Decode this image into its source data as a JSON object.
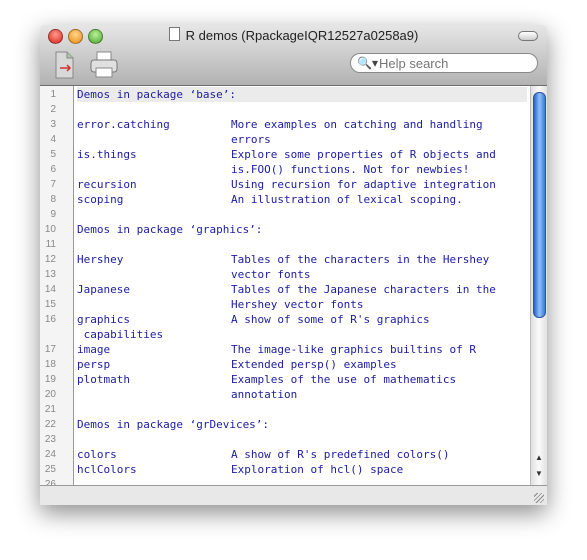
{
  "window": {
    "title": "R demos (RpackageIQR12527a0258a9)"
  },
  "toolbar": {
    "search_placeholder": "Help search",
    "buttons": [
      "export-icon",
      "print-icon"
    ]
  },
  "colors": {
    "text": "#1c1ca0",
    "line_number": "#888888",
    "scroll_thumb": "#3a78d8"
  },
  "rows": [
    {
      "n": "1",
      "a": "Demos in package ‘base’:",
      "b": ""
    },
    {
      "n": "2",
      "a": "",
      "b": ""
    },
    {
      "n": "3",
      "a": "error.catching",
      "b": "More examples on catching and handling"
    },
    {
      "n": "4",
      "a": "",
      "b": "errors"
    },
    {
      "n": "5",
      "a": "is.things",
      "b": "Explore some properties of R objects and"
    },
    {
      "n": "6",
      "a": "",
      "b": "is.FOO() functions. Not for newbies!"
    },
    {
      "n": "7",
      "a": "recursion",
      "b": "Using recursion for adaptive integration"
    },
    {
      "n": "8",
      "a": "scoping",
      "b": "An illustration of lexical scoping."
    },
    {
      "n": "9",
      "a": "",
      "b": ""
    },
    {
      "n": "10",
      "a": "Demos in package ‘graphics’:",
      "b": ""
    },
    {
      "n": "11",
      "a": "",
      "b": ""
    },
    {
      "n": "12",
      "a": "Hershey",
      "b": "Tables of the characters in the Hershey"
    },
    {
      "n": "13",
      "a": "",
      "b": "vector fonts"
    },
    {
      "n": "14",
      "a": "Japanese",
      "b": "Tables of the Japanese characters in the"
    },
    {
      "n": "15",
      "a": "",
      "b": "Hershey vector fonts"
    },
    {
      "n": "16",
      "a": "graphics",
      "b": "A show of some of R's graphics"
    },
    {
      "n": "",
      "a": " capabilities",
      "b": ""
    },
    {
      "n": "17",
      "a": "image",
      "b": "The image-like graphics builtins of R"
    },
    {
      "n": "18",
      "a": "persp",
      "b": "Extended persp() examples"
    },
    {
      "n": "19",
      "a": "plotmath",
      "b": "Examples of the use of mathematics"
    },
    {
      "n": "20",
      "a": "",
      "b": "annotation"
    },
    {
      "n": "21",
      "a": "",
      "b": ""
    },
    {
      "n": "22",
      "a": "Demos in package ‘grDevices’:",
      "b": ""
    },
    {
      "n": "23",
      "a": "",
      "b": ""
    },
    {
      "n": "24",
      "a": "colors",
      "b": "A show of R's predefined colors()"
    },
    {
      "n": "25",
      "a": "hclColors",
      "b": "Exploration of hcl() space"
    },
    {
      "n": "26",
      "a": "",
      "b": ""
    }
  ]
}
